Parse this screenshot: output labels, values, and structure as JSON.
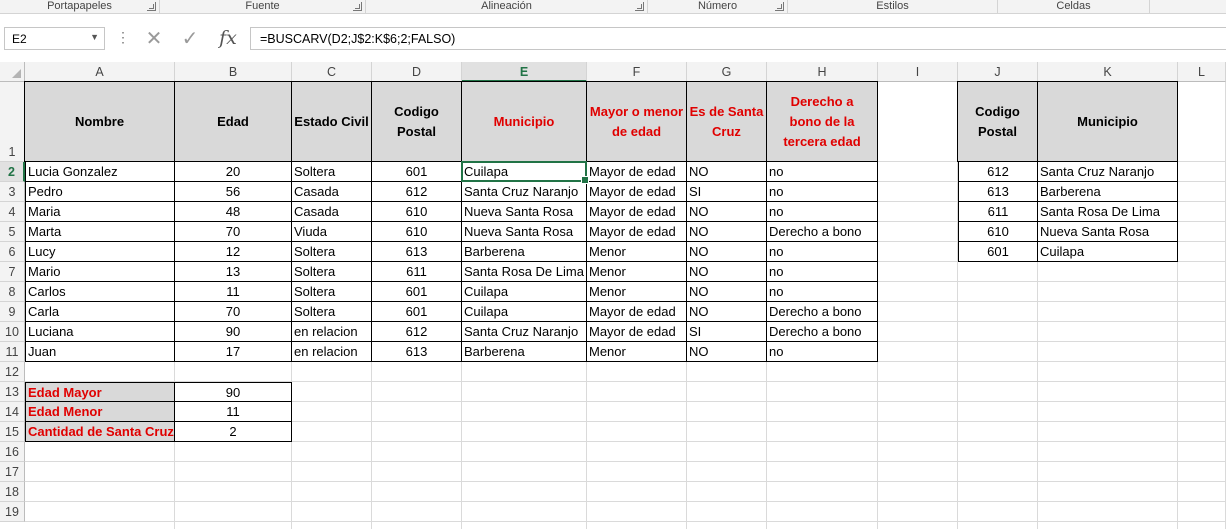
{
  "ribbon": {
    "groups": [
      {
        "label": "Portapapeles"
      },
      {
        "label": "Fuente"
      },
      {
        "label": "Alineación"
      },
      {
        "label": "Número"
      },
      {
        "label": "Estilos"
      },
      {
        "label": "Celdas"
      }
    ]
  },
  "formula_bar": {
    "name_box": "E2",
    "formula": "=BUSCARV(D2;J$2:K$6;2;FALSO)",
    "cancel_glyph": "✕",
    "enter_glyph": "✓",
    "fx_label": "fx",
    "dots": "⋮"
  },
  "grid": {
    "columns": [
      "A",
      "B",
      "C",
      "D",
      "E",
      "F",
      "G",
      "H",
      "I",
      "J",
      "K",
      "L"
    ],
    "rows": [
      "1",
      "2",
      "3",
      "4",
      "5",
      "6",
      "7",
      "8",
      "9",
      "10",
      "11",
      "12",
      "13",
      "14",
      "15",
      "16",
      "17",
      "18",
      "19"
    ],
    "active_cell": "E2"
  },
  "main_table": {
    "headers": [
      "Nombre",
      "Edad",
      "Estado Civil",
      "Codigo Postal",
      "Municipio",
      "Mayor o menor de edad",
      "Es de Santa Cruz",
      "Derecho a bono de la tercera edad"
    ],
    "rows": [
      [
        "Lucia Gonzalez",
        "20",
        "Soltera",
        "601",
        "Cuilapa",
        "Mayor de edad",
        "NO",
        "no"
      ],
      [
        "Pedro",
        "56",
        "Casada",
        "612",
        "Santa Cruz Naranjo",
        "Mayor de edad",
        "SI",
        "no"
      ],
      [
        "Maria",
        "48",
        "Casada",
        "610",
        "Nueva Santa Rosa",
        "Mayor de edad",
        "NO",
        "no"
      ],
      [
        "Marta",
        "70",
        "Viuda",
        "610",
        "Nueva Santa Rosa",
        "Mayor de edad",
        "NO",
        "Derecho a bono"
      ],
      [
        "Lucy",
        "12",
        "Soltera",
        "613",
        "Barberena",
        "Menor",
        "NO",
        "no"
      ],
      [
        "Mario",
        "13",
        "Soltera",
        "611",
        "Santa Rosa De Lima",
        "Menor",
        "NO",
        "no"
      ],
      [
        "Carlos",
        "11",
        "Soltera",
        "601",
        "Cuilapa",
        "Menor",
        "NO",
        "no"
      ],
      [
        "Carla",
        "70",
        "Soltera",
        "601",
        "Cuilapa",
        "Mayor de edad",
        "NO",
        "Derecho a bono"
      ],
      [
        "Luciana",
        "90",
        "en relacion",
        "612",
        "Santa Cruz Naranjo",
        "Mayor de edad",
        "SI",
        "Derecho a bono"
      ],
      [
        "Juan",
        "17",
        "en relacion",
        "613",
        "Barberena",
        "Menor",
        "NO",
        "no"
      ]
    ]
  },
  "summary": {
    "rows": [
      {
        "label": "Edad Mayor",
        "value": "90"
      },
      {
        "label": "Edad Menor",
        "value": "11"
      },
      {
        "label": "Cantidad de Santa Cruz",
        "value": "2"
      }
    ]
  },
  "lookup_table": {
    "headers": [
      "Codigo Postal",
      "Municipio"
    ],
    "rows": [
      [
        "612",
        "Santa Cruz Naranjo"
      ],
      [
        "613",
        "Barberena"
      ],
      [
        "611",
        "Santa Rosa De Lima"
      ],
      [
        "610",
        "Nueva Santa Rosa"
      ],
      [
        "601",
        "Cuilapa"
      ]
    ]
  },
  "colors": {
    "accent": "#217346",
    "header_fill": "#d9d9d9",
    "red_text": "#e00000"
  }
}
